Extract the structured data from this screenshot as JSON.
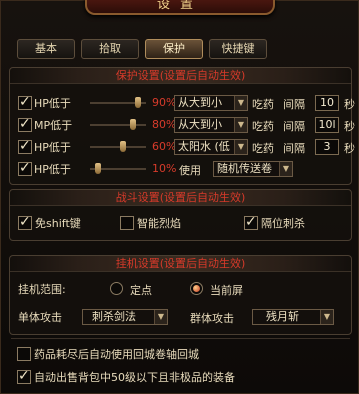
{
  "window": {
    "title": "设置"
  },
  "tabs": [
    {
      "label": "基本",
      "active": false
    },
    {
      "label": "拾取",
      "active": false
    },
    {
      "label": "保护",
      "active": true
    },
    {
      "label": "快捷键",
      "active": false
    }
  ],
  "protect": {
    "header": "保护设置(设置后自动生效)",
    "rows": [
      {
        "label": "HP低于",
        "checked": true,
        "percent": "90%",
        "level": 0.9,
        "mode": "从大到小",
        "action": "吃药",
        "interval_label": "间隔",
        "interval": "10",
        "unit": "秒"
      },
      {
        "label": "MP低于",
        "checked": true,
        "percent": "80%",
        "level": 0.8,
        "mode": "从大到小",
        "action": "吃药",
        "interval_label": "间隔",
        "interval": "10l",
        "unit": "秒"
      },
      {
        "label": "HP低于",
        "checked": true,
        "percent": "60%",
        "level": 0.6,
        "mode": "太阳水 (低",
        "action": "吃药",
        "interval_label": "间隔",
        "interval": "3",
        "unit": "秒"
      },
      {
        "label": "HP低于",
        "checked": true,
        "percent": "10%",
        "level": 0.1,
        "use_label": "使用",
        "mode": "随机传送卷"
      }
    ]
  },
  "combat": {
    "header": "战斗设置(设置后自动生效)",
    "options": [
      {
        "label": "免shift键",
        "checked": true
      },
      {
        "label": "智能烈焰",
        "checked": false
      },
      {
        "label": "隔位刺杀",
        "checked": true
      }
    ]
  },
  "hangup": {
    "header": "挂机设置(设置后自动生效)",
    "range_label": "挂机范围:",
    "range_options": [
      {
        "label": "定点",
        "selected": false
      },
      {
        "label": "当前屏",
        "selected": true
      }
    ],
    "single_label": "单体攻击",
    "single_value": "刺杀剑法",
    "group_label": "群体攻击",
    "group_value": "残月斩"
  },
  "extra": [
    {
      "label": "药品耗尽后自动使用回城卷轴回城",
      "checked": false
    },
    {
      "label": "自动出售背包中50级以下且非极品的装备",
      "checked": true
    }
  ]
}
